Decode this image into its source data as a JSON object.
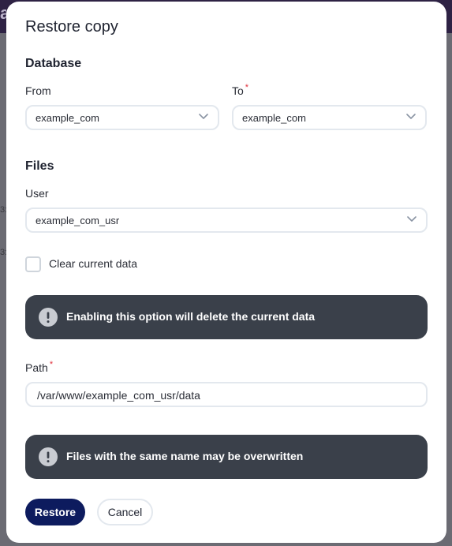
{
  "background": {
    "topbar_glyph": "a",
    "fragment_1": "3:",
    "fragment_2": "3:"
  },
  "dialog": {
    "title": "Restore copy",
    "database": {
      "heading": "Database",
      "from": {
        "label": "From",
        "value": "example_com",
        "icon": "chevron-down-icon"
      },
      "to": {
        "label": "To",
        "required_mark": "*",
        "value": "example_com",
        "icon": "chevron-down-icon"
      }
    },
    "files": {
      "heading": "Files",
      "user": {
        "label": "User",
        "value": "example_com_usr",
        "icon": "chevron-down-icon"
      },
      "clear_checkbox": {
        "label": "Clear current data",
        "checked": false
      },
      "warning_1": {
        "icon": "exclamation-icon",
        "text": "Enabling this option will delete the current data"
      },
      "path": {
        "label": "Path",
        "required_mark": "*",
        "value": "/var/www/example_com_usr/data"
      },
      "warning_2": {
        "icon": "exclamation-icon",
        "text": "Files with the same name may be overwritten"
      }
    },
    "actions": {
      "restore_label": "Restore",
      "cancel_label": "Cancel"
    }
  },
  "colors": {
    "primary": "#0d1b5e",
    "alert_bg": "#3a404a",
    "required": "#e0313d",
    "border": "#e3e8ee"
  }
}
